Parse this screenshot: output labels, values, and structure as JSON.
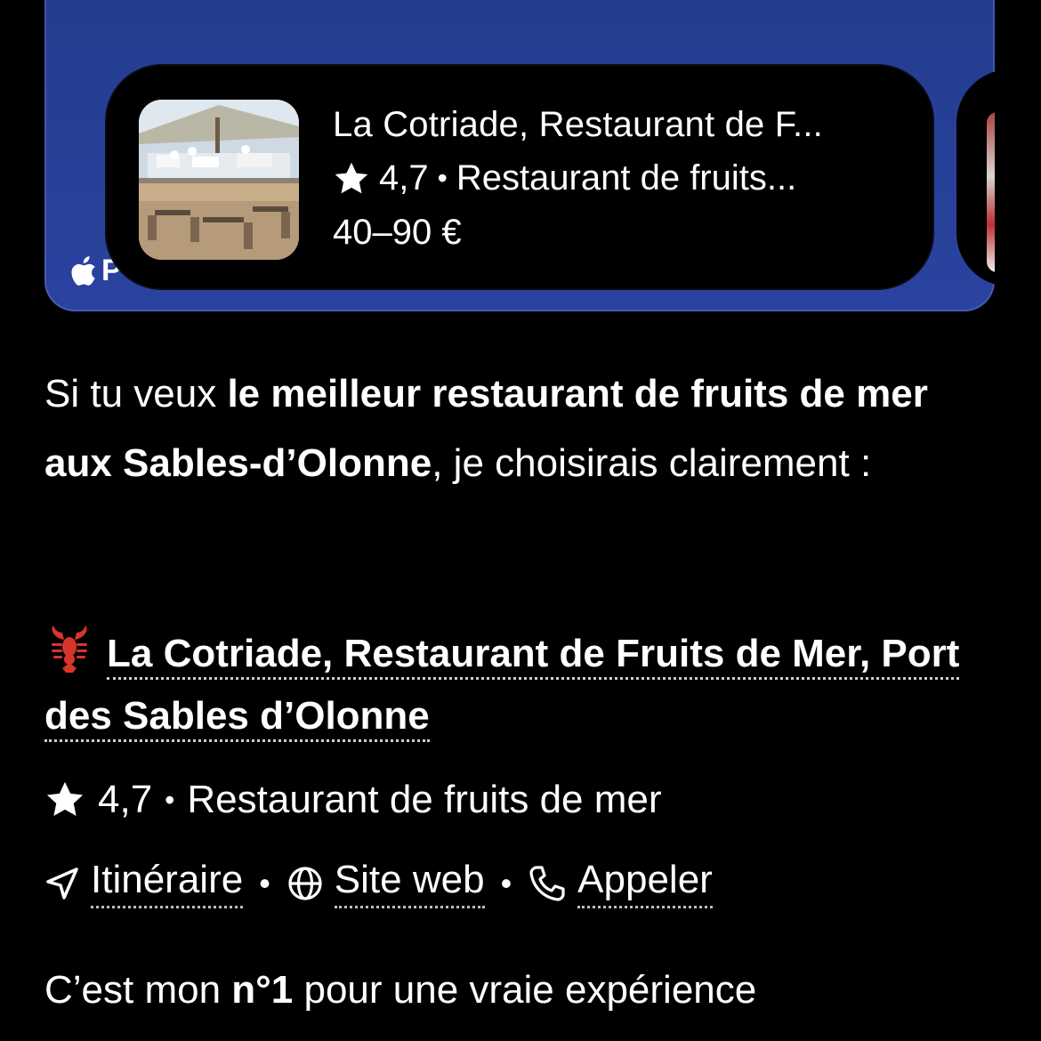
{
  "map_card": {
    "badge_text": "P",
    "place": {
      "title": "La Cotriade, Restaurant de F...",
      "rating": "4,7",
      "category": "Restaurant de fruits...",
      "price": "40–90 €"
    }
  },
  "intro": {
    "prefix": "Si tu veux ",
    "bold": "le meilleur restaurant de fruits de mer aux Sables-d’Olonne",
    "suffix": ", je choisirais clairement :"
  },
  "result": {
    "emoji": "lobster",
    "name": "La Cotriade, Restaurant de Fruits de Mer, Port des Sables d’Olonne",
    "rating": "4,7",
    "category": "Restaurant de fruits de mer"
  },
  "actions": {
    "directions": "Itinéraire",
    "website": "Site web",
    "call": "Appeler",
    "separator": "•"
  },
  "closing": {
    "prefix": "C’est mon ",
    "bold": "n°1",
    "suffix": " pour une vraie expérience"
  },
  "colors": {
    "background": "#000000",
    "map_blue": "#2a43a0",
    "text": "#ffffff"
  },
  "icons": [
    "apple-logo-icon",
    "star-icon",
    "lobster-icon",
    "navigation-arrow-icon",
    "globe-icon",
    "phone-icon"
  ]
}
